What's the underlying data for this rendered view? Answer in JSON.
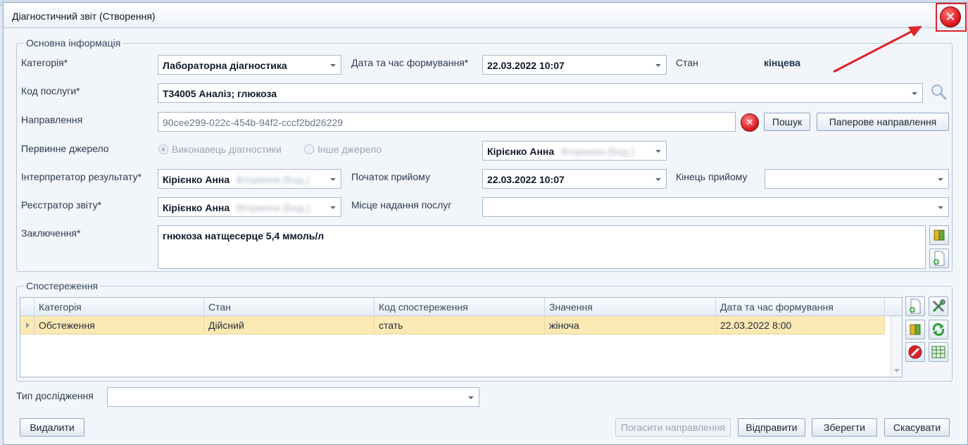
{
  "window": {
    "title": "Діагностичний звіт (Створення)"
  },
  "basic": {
    "legend": "Основна інформація",
    "category_label": "Категорія*",
    "category_value": "Лабораторна діагностика",
    "datetime_label": "Дата та час формування*",
    "datetime_value": "22.03.2022 10:07",
    "state_label": "Стан",
    "state_value": "кінцева",
    "service_label": "Код послуги*",
    "service_value": "Т34005 Аналіз; глюкоза",
    "referral_label": "Направлення",
    "referral_value": "90cee299-022c-454b-94f2-cccf2bd26229",
    "search_button": "Пошук",
    "paper_referral_button": "Паперове направлення",
    "source_label": "Первинне джерело",
    "source_option1": "Виконавець діагностики",
    "source_option2": "Інше джерело",
    "source_person": "Кірієнко Анна",
    "interpreter_label": "Інтерпретатор результату*",
    "interpreter_value": "Кірієнко Анна",
    "reception_start_label": "Початок прийому",
    "reception_start_value": "22.03.2022 10:07",
    "reception_end_label": "Кінець прийому",
    "reception_end_value": "",
    "registrar_label": "Реєстратор звіту*",
    "registrar_value": "Кірієнко Анна",
    "place_label": "Місце надання послуг",
    "place_value": "",
    "conclusion_label": "Заключення*",
    "conclusion_value": "гнюкоза натщесерце  5,4 ммоль/л"
  },
  "observations": {
    "legend": "Спостереження",
    "columns": [
      "Категорія",
      "Стан",
      "Код спостереження",
      "Значення",
      "Дата та час формування"
    ],
    "rows": [
      [
        "Обстеження",
        "Дійсний",
        "стать",
        "жіноча",
        "22.03.2022 8:00"
      ]
    ]
  },
  "study_type": {
    "label": "Тип дослідження",
    "value": ""
  },
  "footer": {
    "delete_button": "Видалити",
    "cancel_referral_button": "Погасити направлення",
    "send_button": "Відправити",
    "save_button": "Зберегти",
    "cancel_button": "Скасувати"
  },
  "colors": {
    "selected_row": "#fde9b4",
    "annotation_red": "#e0242a"
  }
}
